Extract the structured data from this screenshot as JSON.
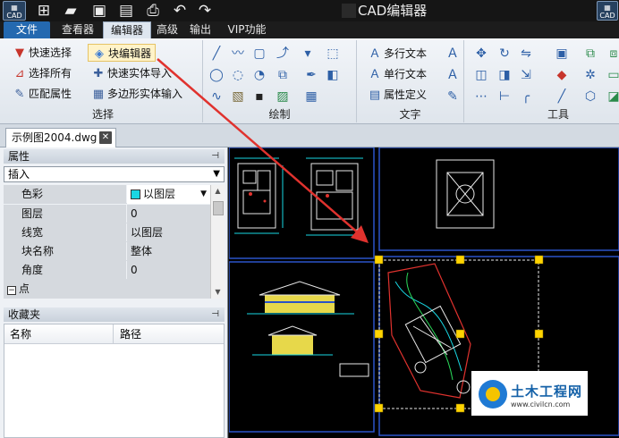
{
  "title_bar": {
    "app_logo": "CAD",
    "title": "CAD编辑器",
    "icons": [
      "new-icon",
      "open-icon",
      "save-icon",
      "save-pdf-icon",
      "print-icon",
      "undo-icon",
      "redo-icon"
    ]
  },
  "menu": {
    "items": [
      "文件",
      "查看器",
      "编辑器",
      "高级",
      "输出",
      "VIP功能"
    ],
    "active": "编辑器"
  },
  "ribbon": {
    "select_group": {
      "label": "选择",
      "buttons": [
        "快速选择",
        "选择所有",
        "匹配属性",
        "块编辑器",
        "快速实体导入",
        "多边形实体输入"
      ]
    },
    "draw_group": {
      "label": "绘制"
    },
    "text_group": {
      "label": "文字",
      "buttons": [
        "多行文本",
        "单行文本",
        "属性定义"
      ]
    },
    "tools_group": {
      "label": "工具"
    }
  },
  "doc_tab": {
    "label": "示例图2004.dwg",
    "close": "✕"
  },
  "properties": {
    "header": "属性",
    "pin": "⊣",
    "object_type": "插入",
    "rows": [
      {
        "name": "色彩",
        "value": "以图层"
      },
      {
        "name": "图层",
        "value": "0"
      },
      {
        "name": "线宽",
        "value": "以图层"
      },
      {
        "name": "块名称",
        "value": "整体"
      },
      {
        "name": "角度",
        "value": "0"
      }
    ],
    "group_row": "点"
  },
  "favorites": {
    "header": "收藏夹",
    "columns": [
      "名称",
      "路径"
    ]
  },
  "watermark": {
    "title": "土木工程网",
    "url": "www.civilcn.com"
  },
  "colors": {
    "accent": "#2469b0",
    "annotation_arrow": "#e0322e",
    "grip": "#ffd400"
  }
}
